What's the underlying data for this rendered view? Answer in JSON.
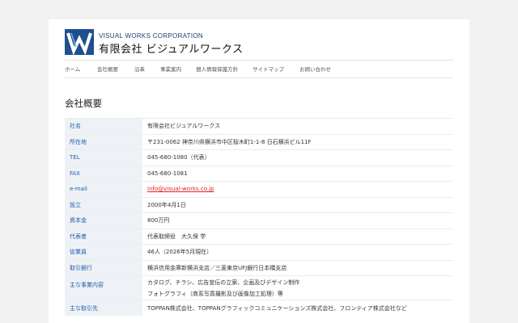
{
  "header": {
    "logo_en": "VISUAL WORKS CORPORATION",
    "logo_jp": "有限会社 ビジュアルワークス"
  },
  "nav": [
    {
      "label": "ホーム",
      "active": false
    },
    {
      "label": "会社概要",
      "active": true
    },
    {
      "label": "沿革",
      "active": false
    },
    {
      "label": "事業案内",
      "active": false
    },
    {
      "label": "個人情報保護方針",
      "active": false
    },
    {
      "label": "サイトマップ",
      "active": false
    },
    {
      "label": "お問い合わせ",
      "active": false
    }
  ],
  "page_title": "会社概要",
  "rows": [
    {
      "label": "社名",
      "value": "有限会社ビジュアルワークス"
    },
    {
      "label": "所在地",
      "value": "〒231-0062 神奈川県横浜市中区桜木町1-1-8 日石横浜ビル11F"
    },
    {
      "label": "TEL",
      "value": "045-680-1080（代表）"
    },
    {
      "label": "FAX",
      "value": "045-680-1081"
    },
    {
      "label": "e-mail",
      "value": "info@visual-works.co.jp",
      "link": true
    },
    {
      "label": "設立",
      "value": "2000年4月1日"
    },
    {
      "label": "資本金",
      "value": "800万円"
    },
    {
      "label": "代表者",
      "value": "代表取締役　大久保 学"
    },
    {
      "label": "従業員",
      "value": "46人（2026年5月現在）"
    },
    {
      "label": "取引銀行",
      "value": "横浜信用金庫新横浜支店／三菱東京UFJ銀行日本橋支店"
    },
    {
      "label": "主な事業内容",
      "value": "カタログ、チラシ、広告宣伝の立案、企画及びデザイン制作",
      "value2": "フォトグラフィ（商系写真撮影及び画像加工処理）等"
    },
    {
      "label": "主な取引先",
      "value": "TOPPAN株式会社、TOPPANグラフィックコミュニケーションズ株式会社、フロンティア株式会社など"
    }
  ],
  "colors": {
    "accent": "#1f5fa8",
    "label_bg": "#eef2f7",
    "email": "#d22222"
  }
}
